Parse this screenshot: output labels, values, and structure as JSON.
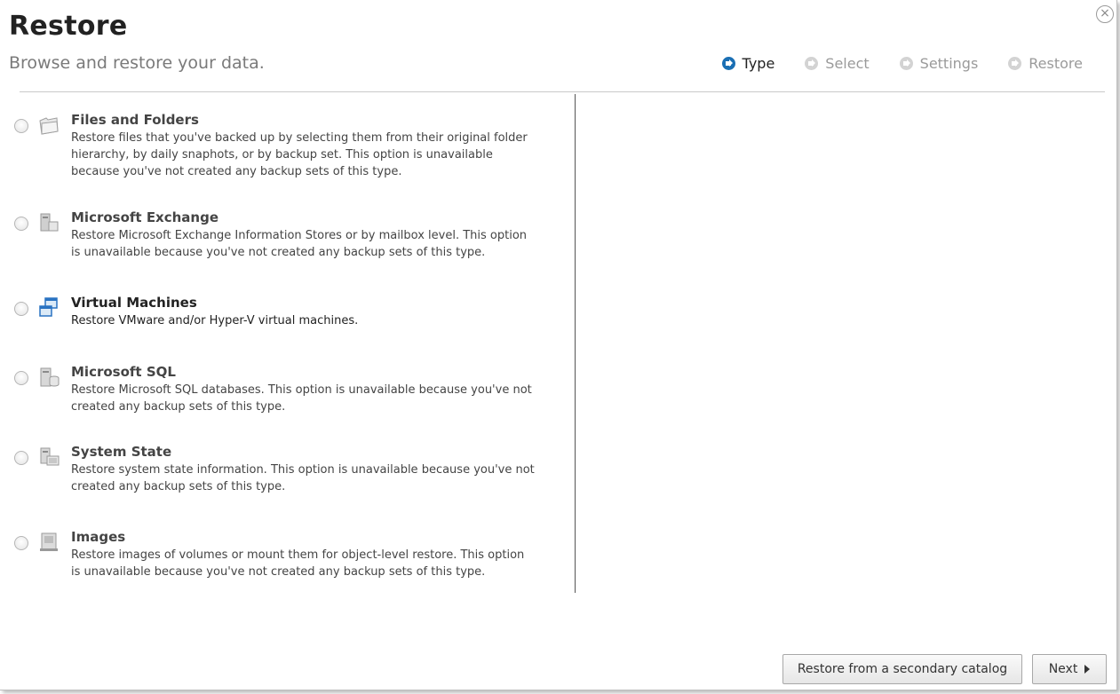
{
  "header": {
    "title": "Restore",
    "subtitle": "Browse and restore your data.",
    "close_glyph": "×"
  },
  "steps": [
    {
      "label": "Type",
      "active": true
    },
    {
      "label": "Select",
      "active": false
    },
    {
      "label": "Settings",
      "active": false
    },
    {
      "label": "Restore",
      "active": false
    }
  ],
  "options": [
    {
      "title": "Files and Folders",
      "description_lines": [
        "Restore files that you've backed up by selecting them from their original folder",
        "hierarchy, by daily snaphots, or by backup set. This option is unavailable",
        "because you've not created any backup sets of this type."
      ],
      "icon": "folder-icon",
      "enabled": false
    },
    {
      "title": "Microsoft Exchange",
      "description_lines": [
        "Restore Microsoft Exchange Information Stores or by mailbox level. This option",
        "is unavailable because you've not created any backup sets of this type."
      ],
      "icon": "exchange-server-icon",
      "enabled": false
    },
    {
      "title": "Virtual Machines",
      "description_lines": [
        "Restore VMware and/or Hyper-V virtual machines."
      ],
      "icon": "virtual-machines-icon",
      "enabled": true
    },
    {
      "title": "Microsoft SQL",
      "description_lines": [
        "Restore Microsoft SQL databases. This option is unavailable because you've not",
        "created any backup sets of this type."
      ],
      "icon": "sql-server-icon",
      "enabled": false
    },
    {
      "title": "System State",
      "description_lines": [
        "Restore system state information. This option is unavailable because you've not",
        "created any backup sets of this type."
      ],
      "icon": "system-state-icon",
      "enabled": false
    },
    {
      "title": "Images",
      "description_lines": [
        "Restore images of volumes or mount them for object-level restore. This option",
        "is unavailable because you've not created any backup sets of this type."
      ],
      "icon": "disk-image-icon",
      "enabled": false
    }
  ],
  "footer": {
    "secondary_catalog_label": "Restore from a secondary catalog",
    "next_label": "Next"
  },
  "colors": {
    "accent": "#1a6fb4",
    "inactive_step": "#9a9a9a",
    "divider": "#555555"
  }
}
